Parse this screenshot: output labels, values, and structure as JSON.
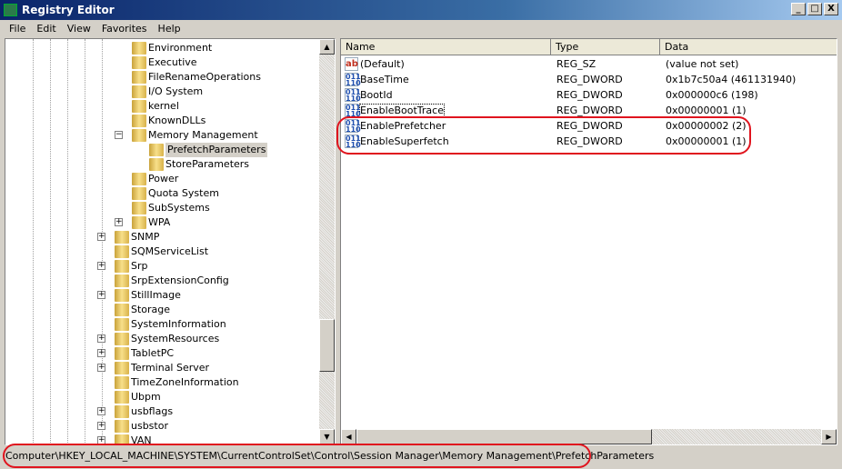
{
  "window": {
    "title": "Registry Editor",
    "buttons": [
      "_",
      "□",
      "X"
    ]
  },
  "menu": [
    "File",
    "Edit",
    "View",
    "Favorites",
    "Help"
  ],
  "tree": [
    {
      "label": "Environment",
      "level": 1
    },
    {
      "label": "Executive",
      "level": 1
    },
    {
      "label": "FileRenameOperations",
      "level": 1
    },
    {
      "label": "I/O System",
      "level": 1
    },
    {
      "label": "kernel",
      "level": 1
    },
    {
      "label": "KnownDLLs",
      "level": 1
    },
    {
      "label": "Memory Management",
      "level": 1,
      "expander": "-"
    },
    {
      "label": "PrefetchParameters",
      "level": 2,
      "selected": true
    },
    {
      "label": "StoreParameters",
      "level": 2
    },
    {
      "label": "Power",
      "level": 1
    },
    {
      "label": "Quota System",
      "level": 1
    },
    {
      "label": "SubSystems",
      "level": 1
    },
    {
      "label": "WPA",
      "level": 1,
      "expander": "+"
    },
    {
      "label": "SNMP",
      "level": 0,
      "expander": "+"
    },
    {
      "label": "SQMServiceList",
      "level": 0
    },
    {
      "label": "Srp",
      "level": 0,
      "expander": "+"
    },
    {
      "label": "SrpExtensionConfig",
      "level": 0
    },
    {
      "label": "StillImage",
      "level": 0,
      "expander": "+"
    },
    {
      "label": "Storage",
      "level": 0
    },
    {
      "label": "SystemInformation",
      "level": 0
    },
    {
      "label": "SystemResources",
      "level": 0,
      "expander": "+"
    },
    {
      "label": "TabletPC",
      "level": 0,
      "expander": "+"
    },
    {
      "label": "Terminal Server",
      "level": 0,
      "expander": "+"
    },
    {
      "label": "TimeZoneInformation",
      "level": 0
    },
    {
      "label": "Ubpm",
      "level": 0
    },
    {
      "label": "usbflags",
      "level": 0,
      "expander": "+"
    },
    {
      "label": "usbstor",
      "level": 0,
      "expander": "+"
    },
    {
      "label": "VAN",
      "level": 0,
      "expander": "+"
    }
  ],
  "columns": [
    "Name",
    "Type",
    "Data"
  ],
  "values": [
    {
      "name": "(Default)",
      "type": "REG_SZ",
      "data": "(value not set)",
      "icon": "string-value-icon"
    },
    {
      "name": "BaseTime",
      "type": "REG_DWORD",
      "data": "0x1b7c50a4 (461131940)",
      "icon": "dword-value-icon"
    },
    {
      "name": "BootId",
      "type": "REG_DWORD",
      "data": "0x000000c6 (198)",
      "icon": "dword-value-icon"
    },
    {
      "name": "EnableBootTrace",
      "type": "REG_DWORD",
      "data": "0x00000001 (1)",
      "icon": "dword-value-icon",
      "focused": true
    },
    {
      "name": "EnablePrefetcher",
      "type": "REG_DWORD",
      "data": "0x00000002 (2)",
      "icon": "dword-value-icon"
    },
    {
      "name": "EnableSuperfetch",
      "type": "REG_DWORD",
      "data": "0x00000001 (1)",
      "icon": "dword-value-icon"
    }
  ],
  "status": "Computer\\HKEY_LOCAL_MACHINE\\SYSTEM\\CurrentControlSet\\Control\\Session Manager\\Memory Management\\PrefetchParameters",
  "colors": {
    "annotation": "#e0141e",
    "titlebar": "#0a246a"
  }
}
